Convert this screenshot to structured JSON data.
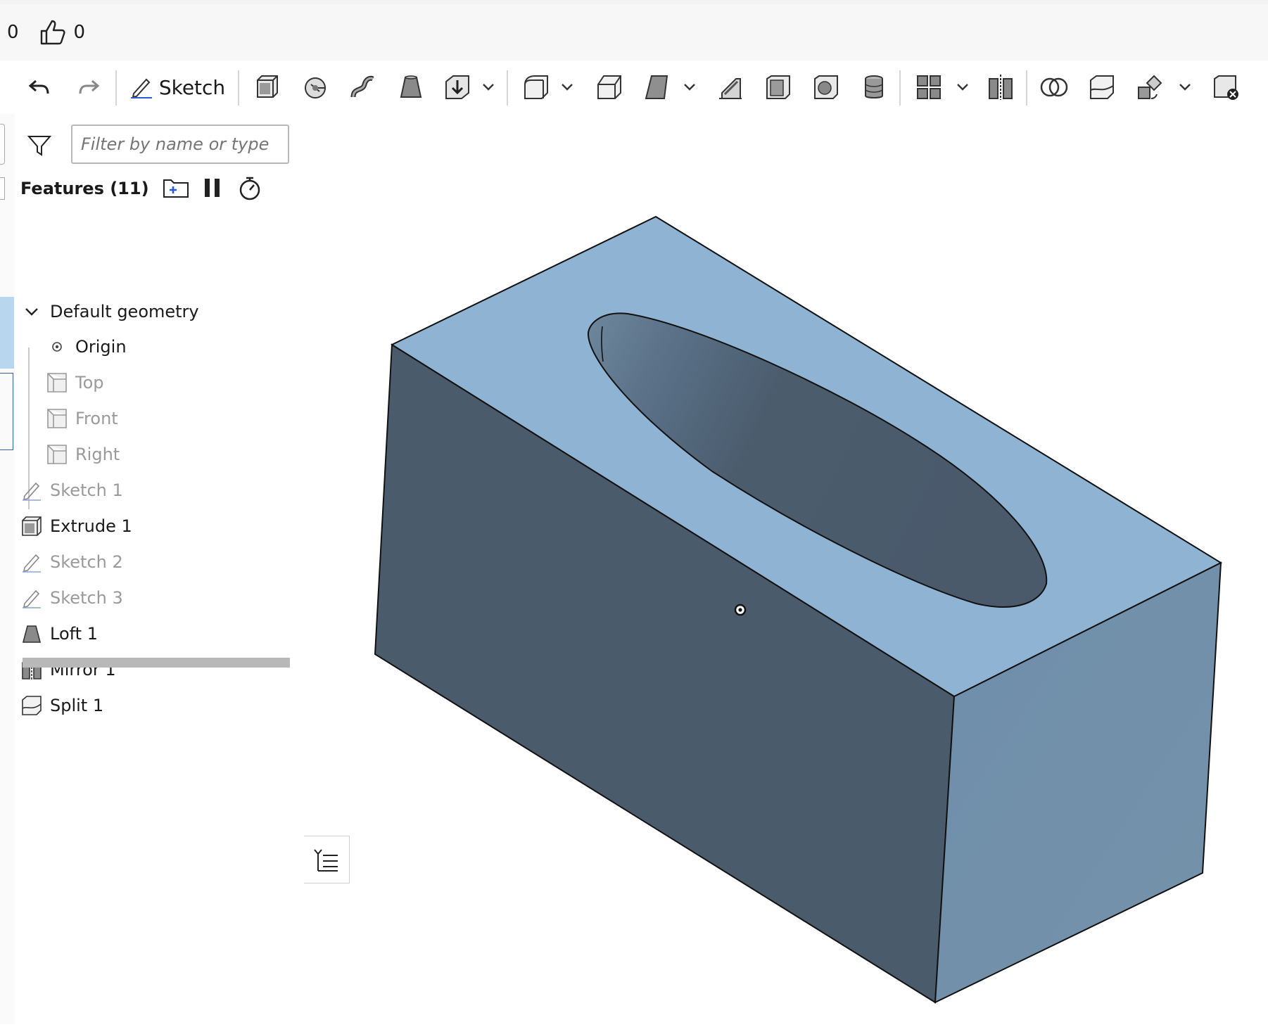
{
  "header": {
    "count_left": "0",
    "likes": "0"
  },
  "toolbar": {
    "sketch_label": "Sketch",
    "icons": [
      "undo-icon",
      "redo-icon",
      "sketch-icon",
      "extrude-icon",
      "revolve-icon",
      "sweep-icon",
      "loft-icon",
      "thicken-icon",
      "fillet-icon",
      "chamfer-icon",
      "draft-icon",
      "rib-icon",
      "shell-icon",
      "hole-icon",
      "thread-icon",
      "pattern-icon",
      "mirror-icon",
      "boolean-icon",
      "split-icon",
      "transform-icon",
      "delete-part-icon"
    ]
  },
  "feature_panel": {
    "filter_placeholder": "Filter by name or type",
    "title": "Features (11)",
    "default_geometry_label": "Default geometry",
    "items": [
      {
        "label": "Origin",
        "icon": "origin-icon",
        "dim": false,
        "indent": true
      },
      {
        "label": "Top",
        "icon": "plane-icon",
        "dim": true,
        "indent": true
      },
      {
        "label": "Front",
        "icon": "plane-icon",
        "dim": true,
        "indent": true
      },
      {
        "label": "Right",
        "icon": "plane-icon",
        "dim": true,
        "indent": true
      },
      {
        "label": "Sketch 1",
        "icon": "sketch-icon",
        "dim": true,
        "indent": false
      },
      {
        "label": "Extrude 1",
        "icon": "extrude-icon",
        "dim": false,
        "indent": false
      },
      {
        "label": "Sketch 2",
        "icon": "sketch-icon",
        "dim": true,
        "indent": false
      },
      {
        "label": "Sketch 3",
        "icon": "sketch-icon",
        "dim": true,
        "indent": false
      },
      {
        "label": "Loft 1",
        "icon": "loft-icon",
        "dim": false,
        "indent": false
      },
      {
        "label": "Mirror 1",
        "icon": "mirror-icon",
        "dim": false,
        "indent": false
      },
      {
        "label": "Split 1",
        "icon": "split-icon",
        "dim": false,
        "indent": false
      }
    ]
  },
  "colors": {
    "top_face": "#8fb3d3",
    "front_face": "#4a5b6c",
    "side_face": "#7090aa",
    "pocket_dark": "#4a5a6b"
  }
}
